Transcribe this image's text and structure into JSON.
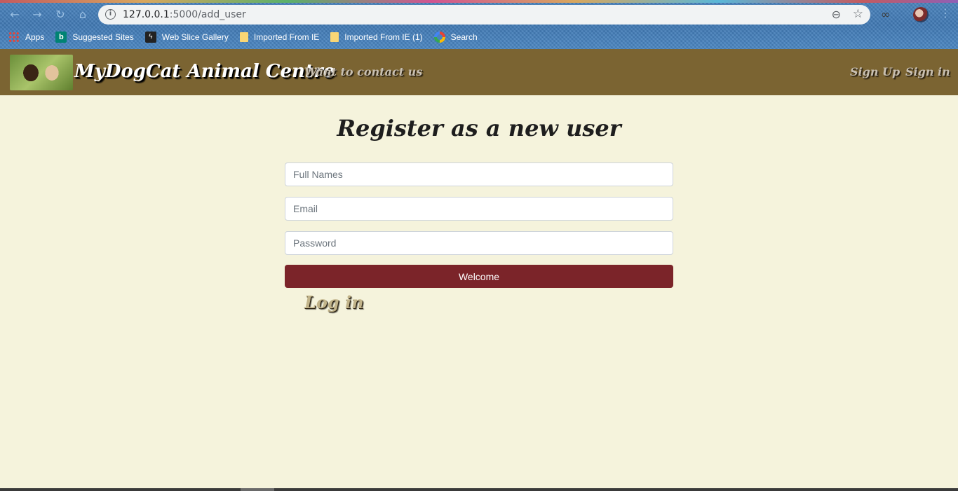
{
  "browser": {
    "url_host": "127.0.0.1",
    "url_path": ":5000/add_user",
    "icons": [
      "back-icon",
      "forward-icon",
      "reload-icon",
      "home-icon",
      "info-icon",
      "zoom-icon",
      "star-icon",
      "extension-icon",
      "profile-avatar",
      "menu-icon"
    ],
    "bookmarks": [
      {
        "label": "Apps",
        "icon": "apps-icon"
      },
      {
        "label": "Suggested Sites",
        "icon": "bing-icon"
      },
      {
        "label": "Web Slice Gallery",
        "icon": "web-slice-icon"
      },
      {
        "label": "Imported From IE",
        "icon": "folder-icon"
      },
      {
        "label": "Imported From IE (1)",
        "icon": "folder-icon"
      },
      {
        "label": "Search",
        "icon": "search-icon"
      }
    ]
  },
  "header": {
    "brand": "MyDogCat Animal Centre",
    "contact": "Want to contact us",
    "signup": "Sign Up",
    "signin": "Sign in",
    "background_color": "#7b6432"
  },
  "main": {
    "title": "Register as a new user",
    "fields": {
      "full_names_placeholder": "Full Names",
      "email_placeholder": "Email",
      "password_placeholder": "Password"
    },
    "submit_label": "Welcome",
    "submit_color": "#7b2429",
    "login_label": "Log in",
    "background_color": "#f5f3dc"
  }
}
